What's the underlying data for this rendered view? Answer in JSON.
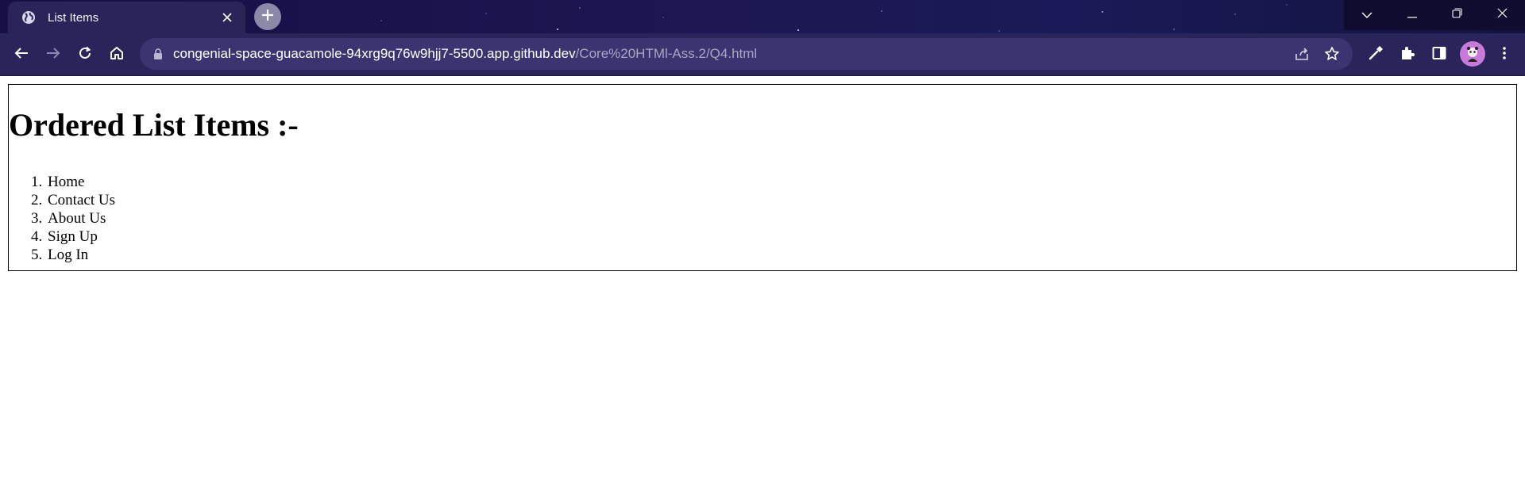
{
  "browser": {
    "tab": {
      "title": "List Items"
    },
    "address_bar": {
      "host": "congenial-space-guacamole-94xrg9q76w9hjj7-5500.app.github.dev",
      "path": "/Core%20HTMl-Ass.2/Q4.html"
    },
    "colors": {
      "titlebar": "#170f45",
      "toolbar": "#29255a",
      "omnibox": "#3a3570",
      "avatar": "#c77ad8"
    },
    "icons": [
      "globe-icon",
      "close-icon",
      "plus-icon",
      "chevron-down-icon",
      "minimize-icon",
      "restore-icon",
      "close-window-icon",
      "back-arrow-icon",
      "forward-arrow-icon",
      "reload-icon",
      "home-icon",
      "lock-icon",
      "share-icon",
      "star-icon",
      "eyedropper-icon",
      "puzzle-icon",
      "side-panel-icon",
      "avatar",
      "kebab-menu-icon"
    ]
  },
  "page": {
    "heading": "Ordered List Items :-",
    "list": [
      {
        "num": "1.",
        "label": "Home"
      },
      {
        "num": "2.",
        "label": "Contact Us"
      },
      {
        "num": "3.",
        "label": "About Us"
      },
      {
        "num": "4.",
        "label": "Sign Up"
      },
      {
        "num": "5.",
        "label": "Log In"
      }
    ]
  }
}
